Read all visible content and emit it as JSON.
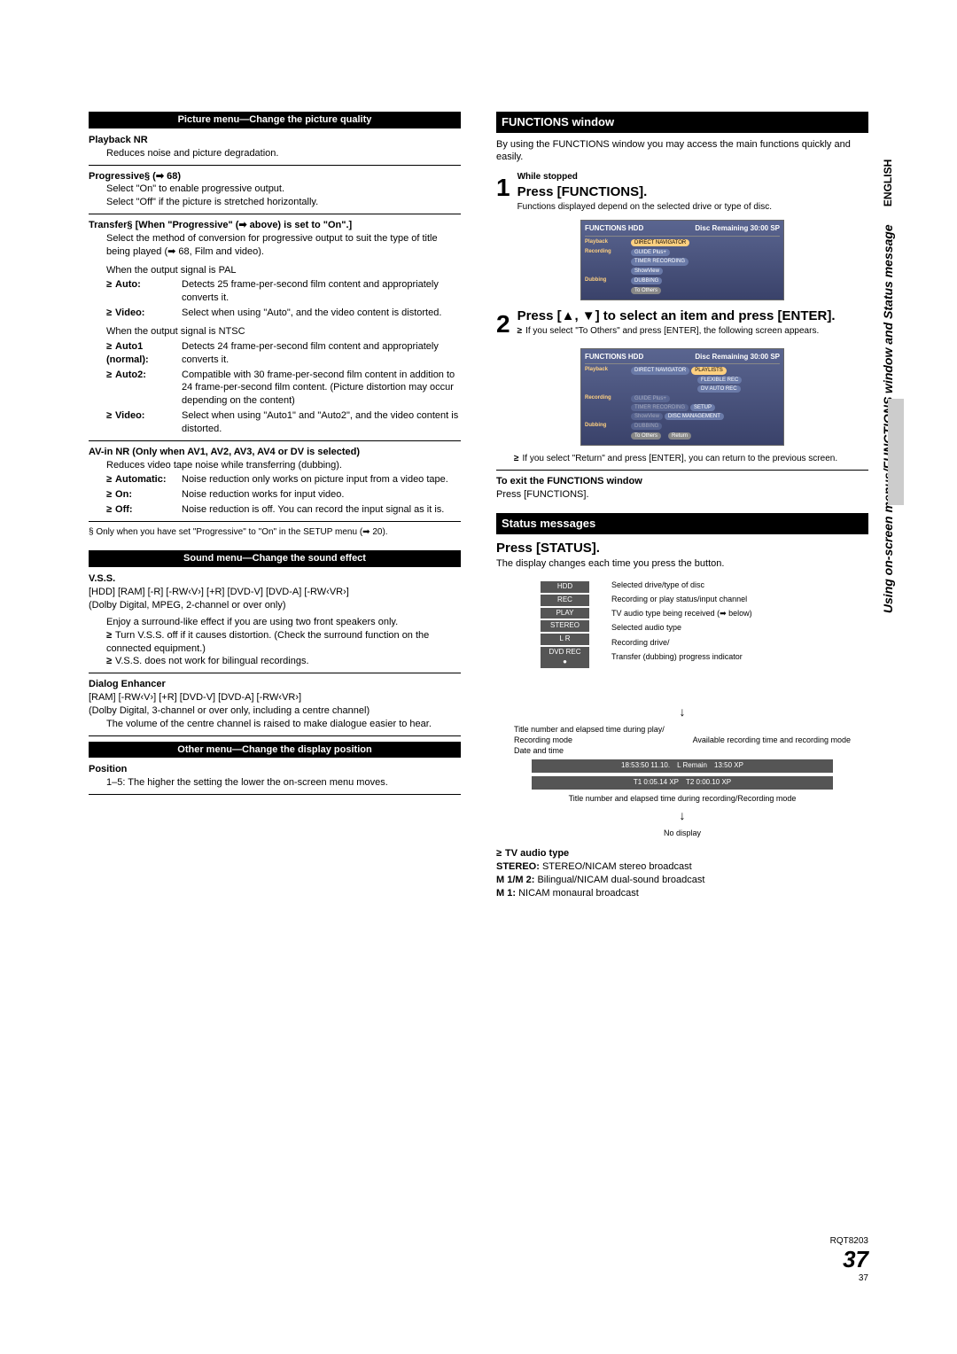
{
  "left": {
    "pictureMenuTitle": "Picture menu—Change the picture quality",
    "playbackNR": {
      "title": "Playback NR",
      "desc": "Reduces noise and picture degradation."
    },
    "progressive": {
      "title": "Progressive§ (➡ 68)",
      "line1": "Select \"On\" to enable progressive output.",
      "line2": "Select \"Off\" if the picture is stretched horizontally."
    },
    "transfer": {
      "title": "Transfer§ [When \"Progressive\" (➡ above) is set to \"On\".]",
      "desc": "Select the method of conversion for progressive output to suit the type of title being played (➡ 68, Film and video).",
      "palTitle": "When the output signal is PAL",
      "pal": {
        "auto": "Detects 25 frame-per-second film content and appropriately converts it.",
        "video": "Select when using \"Auto\", and the video content is distorted."
      },
      "ntscTitle": "When the output signal is NTSC",
      "ntsc": {
        "auto1": "Detects 24 frame-per-second film content and appropriately converts it.",
        "auto2": "Compatible with 30 frame-per-second film content in addition to 24 frame-per-second film content. (Picture distortion may occur depending on the content)",
        "video": "Select when using \"Auto1\" and \"Auto2\", and the video content is distorted."
      }
    },
    "avinNR": {
      "title": "AV-in NR (Only when AV1, AV2, AV3, AV4 or DV is selected)",
      "desc": "Reduces video tape noise while transferring (dubbing).",
      "automatic": "Noise reduction only works on picture input from a video tape.",
      "on": "Noise reduction works for input video.",
      "off": "Noise reduction is off. You can record the input signal as it is."
    },
    "footnote": "§ Only when you have set \"Progressive\" to \"On\" in the SETUP menu (➡ 20).",
    "soundMenuTitle": "Sound menu—Change the sound effect",
    "vss": {
      "title": "V.S.S.",
      "formats": "[HDD] [RAM] [-R] [-RW‹V›] [+R] [DVD-V] [DVD-A] [-RW‹VR›]",
      "sub": "(Dolby Digital, MPEG, 2-channel or over only)",
      "b1": "Enjoy a surround-like effect if you are using two front speakers only.",
      "b2": "Turn V.S.S. off if it causes distortion. (Check the surround function on the connected equipment.)",
      "b3": "V.S.S. does not work for bilingual recordings."
    },
    "dialog": {
      "title": "Dialog Enhancer",
      "formats": "[RAM] [-RW‹V›] [+R] [DVD-V] [DVD-A] [-RW‹VR›]",
      "sub": "(Dolby Digital, 3-channel or over only, including a centre channel)",
      "desc": "The volume of the centre channel is raised to make dialogue easier to hear."
    },
    "otherMenuTitle": "Other menu—Change the display position",
    "position": {
      "title": "Position",
      "desc": "1–5: The higher the setting the lower the on-screen menu moves."
    }
  },
  "right": {
    "functionsTitle": "FUNCTIONS window",
    "functionsIntro": "By using the FUNCTIONS window you may access the main functions quickly and easily.",
    "step1": {
      "label": "While stopped",
      "action": "Press [FUNCTIONS].",
      "note": "Functions displayed depend on the selected drive or type of disc."
    },
    "step2": {
      "action": "Press [▲, ▼] to select an item and press [ENTER].",
      "b1": "If you select \"To Others\" and press [ENTER], the following screen appears.",
      "b2": "If you select \"Return\" and press [ENTER], you can return to the previous screen."
    },
    "exit": {
      "title": "To exit the FUNCTIONS window",
      "desc": "Press [FUNCTIONS]."
    },
    "statusTitle": "Status messages",
    "pressStatus": "Press [STATUS].",
    "statusIntro": "The display changes each time you press the button.",
    "status": {
      "box1": "HDD",
      "box2": "REC",
      "box3": "PLAY",
      "box4": "STEREO",
      "box5": "L R",
      "box6": "DVD REC ●",
      "lab1": "Selected drive/type of disc",
      "lab2": "Recording or play status/input channel",
      "lab3": "TV audio type being received (➡ below)",
      "lab3b": "Selected audio type",
      "lab4": "Recording drive/",
      "lab4b": "Transfer (dubbing) progress indicator",
      "mid1": "Title number and elapsed time during play/",
      "mid2": "Recording mode",
      "mid3": "Available recording time and recording mode",
      "mid4": "Date and time",
      "bar1a": "18:53:50 11.10.",
      "bar1b": "L Remain",
      "bar1c": "13:50 XP",
      "bar2a": "T1   0:05.14  XP",
      "bar2b": "T2   0:00.10  XP",
      "bottom1": "Title number and elapsed time during recording/Recording mode",
      "nodisp": "No display"
    },
    "tvAudio": {
      "title": "TV audio type",
      "stereo": "STEREO/NICAM stereo broadcast",
      "m1m2": "Bilingual/NICAM dual-sound broadcast",
      "m1": "NICAM monaural broadcast"
    },
    "osd1": {
      "title": "FUNCTIONS",
      "drive": "HDD",
      "remaining": "Disc Remaining  30:00 SP",
      "playback": "Playback",
      "playbackBtn": "DIRECT NAVIGATOR",
      "recording": "Recording",
      "rec1": "GUIDE Plus+",
      "rec2": "TIMER RECORDING",
      "rec3": "ShowView",
      "dubbing": "Dubbing",
      "dub1": "DUBBING",
      "toOthers": "To Others"
    },
    "osd2": {
      "title": "FUNCTIONS",
      "drive": "HDD",
      "remaining": "Disc Remaining  30:00 SP",
      "playback": "Playback",
      "pb1": "DIRECT NAVIGATOR",
      "pb2": "PLAYLISTS",
      "pb3": "FLEXIBLE REC",
      "pb4": "DV AUTO REC",
      "recording": "Recording",
      "rec1": "GUIDE Plus+",
      "rec2": "TIMER RECORDING",
      "rec3": "ShowView",
      "setup": "SETUP",
      "discmgmt": "DISC MANAGEMENT",
      "dubbing": "Dubbing",
      "dub1": "DUBBING",
      "toOthers": "To Others",
      "return": "Return"
    }
  },
  "sidebar": {
    "lang": "ENGLISH",
    "text": "Using on-screen menus/FUNCTIONS window and Status message"
  },
  "footer": {
    "code": "RQT8203",
    "big": "37",
    "small": "37"
  }
}
